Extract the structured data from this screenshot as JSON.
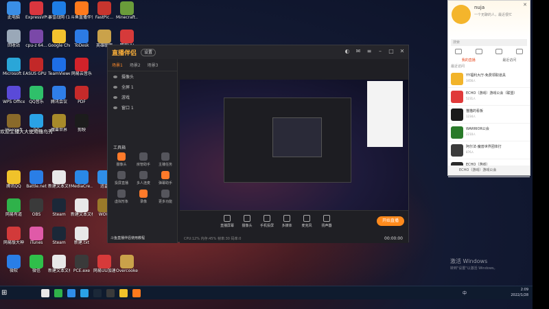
{
  "desktop": {
    "icons": [
      {
        "label": "此电脑",
        "color": "#3a8ee6",
        "col": 0,
        "row": 0
      },
      {
        "label": "ExpressVPN",
        "color": "#d9363e",
        "col": 1,
        "row": 0
      },
      {
        "label": "暴雪战网 (1)",
        "color": "#1e7ee6",
        "col": 2,
        "row": 0
      },
      {
        "label": "斗鱼直播伴侣",
        "color": "#ff7a1c",
        "col": 3,
        "row": 0
      },
      {
        "label": "FastPic...",
        "color": "#c7352e",
        "col": 4,
        "row": 0
      },
      {
        "label": "Minecraft...",
        "color": "#6a9c3a",
        "col": 5,
        "row": 0
      },
      {
        "label": "回收站",
        "color": "#9aa8b8",
        "col": 0,
        "row": 1
      },
      {
        "label": "cpu-z 64...",
        "color": "#7a48a8",
        "col": 1,
        "row": 1
      },
      {
        "label": "Google Chrome",
        "color": "#f2c12e",
        "col": 2,
        "row": 1
      },
      {
        "label": "ToDesk",
        "color": "#2c7be5",
        "col": 3,
        "row": 1
      },
      {
        "label": "英雄联盟",
        "color": "#caa24a",
        "col": 4,
        "row": 1
      },
      {
        "label": "网易UU",
        "color": "#d63a3a",
        "col": 5,
        "row": 1
      },
      {
        "label": "Microsoft Edge",
        "color": "#2aa6d8",
        "col": 0,
        "row": 2
      },
      {
        "label": "ASUS GPU Tweak II",
        "color": "#c22828",
        "col": 1,
        "row": 2
      },
      {
        "label": "TeamViewer",
        "color": "#1e6ee6",
        "col": 2,
        "row": 2
      },
      {
        "label": "网易云音乐",
        "color": "#d2222a",
        "col": 3,
        "row": 2
      },
      {
        "label": "WPS Office",
        "color": "#5a4ad8",
        "col": 0,
        "row": 3
      },
      {
        "label": "QQ音乐",
        "color": "#2fc06a",
        "col": 1,
        "row": 3
      },
      {
        "label": "腾讯会议",
        "color": "#2f7ee8",
        "col": 2,
        "row": 3
      },
      {
        "label": "PDF",
        "color": "#c62a2a",
        "col": 3,
        "row": 3
      },
      {
        "label": "Warcraft",
        "color": "#8a6a2a",
        "col": 0,
        "row": 4
      },
      {
        "label": "QQ",
        "color": "#2aa2e6",
        "col": 1,
        "row": 4
      },
      {
        "label": "魔兽世界",
        "color": "#a88a2a",
        "col": 2,
        "row": 4
      },
      {
        "label": "剪映",
        "color": "#1c1c1c",
        "col": 3,
        "row": 4
      },
      {
        "label": "腾讯QQ",
        "color": "#f0c22a",
        "col": 0,
        "row": 6
      },
      {
        "label": "Battle.net",
        "color": "#2a7ee6",
        "col": 1,
        "row": 6
      },
      {
        "label": "新建文本文档",
        "color": "#e8e8e8",
        "col": 2,
        "row": 6
      },
      {
        "label": "MediaCre...",
        "color": "#2a88e6",
        "col": 3,
        "row": 6
      },
      {
        "label": "迅雷",
        "color": "#2f8ee8",
        "col": 4,
        "row": 6
      },
      {
        "label": "网易有道",
        "color": "#2fb24a",
        "col": 0,
        "row": 7
      },
      {
        "label": "OBS",
        "color": "#3a3a3a",
        "col": 1,
        "row": 7
      },
      {
        "label": "Steam",
        "color": "#1b2838",
        "col": 2,
        "row": 7
      },
      {
        "label": "新建文本文档.txt",
        "color": "#e8e8e8",
        "col": 3,
        "row": 7
      },
      {
        "label": "WOW",
        "color": "#9a7a2a",
        "col": 4,
        "row": 7
      },
      {
        "label": "网易版大神",
        "color": "#d23a3a",
        "col": 0,
        "row": 8
      },
      {
        "label": "iTunes",
        "color": "#e05aa8",
        "col": 1,
        "row": 8
      },
      {
        "label": "Steam",
        "color": "#1b2838",
        "col": 2,
        "row": 8
      },
      {
        "label": "新建.txt",
        "color": "#e8e8e8",
        "col": 3,
        "row": 8
      },
      {
        "label": "微软",
        "color": "#2a7ee6",
        "col": 0,
        "row": 9
      },
      {
        "label": "微信",
        "color": "#2fbf4a",
        "col": 1,
        "row": 9
      },
      {
        "label": "新建文本文档 (4).txt",
        "color": "#e8e8e8",
        "col": 2,
        "row": 9
      },
      {
        "label": "PCE.exe",
        "color": "#3a3a3a",
        "col": 3,
        "row": 9
      },
      {
        "label": "网易UU加速器",
        "color": "#d63a3a",
        "col": 4,
        "row": 9
      },
      {
        "label": "Overcooked",
        "color": "#caa24a",
        "col": 5,
        "row": 9
      }
    ],
    "overlay_text": "欢迎主播大大使用撸鸟秀",
    "activate_title": "激活 Windows",
    "activate_sub": "转到\"设置\"以激活 Windows。"
  },
  "app": {
    "title": "直播伴侣",
    "badge": "设置",
    "scene_tabs": [
      "场景1",
      "场景2",
      "场景3"
    ],
    "active_scene": 0,
    "sources": [
      "摄像头",
      "全屏 1",
      "游戏",
      "窗口 1"
    ],
    "tools_label": "工具箱",
    "tools": [
      {
        "label": "摄像头",
        "hot": true
      },
      {
        "label": "房管助手",
        "hot": false
      },
      {
        "label": "主播任务",
        "hot": false
      },
      {
        "label": "投屏直播",
        "hot": false
      },
      {
        "label": "多人连麦",
        "hot": false
      },
      {
        "label": "弹幕助手",
        "hot": true
      },
      {
        "label": "虚拟形象",
        "hot": false
      },
      {
        "label": "录像",
        "hot": true
      },
      {
        "label": "更多功能",
        "hot": false
      }
    ],
    "notice": "斗鱼直播伴侣使用教程",
    "bottom_buttons": [
      "直播屏幕",
      "摄像头",
      "手机投屏",
      "多媒体",
      "麦克风",
      "扬声器"
    ],
    "go_live": "开始直播",
    "stats": "CPU:12%   内存:45%   帧率:30   码率:0",
    "timer": "00:00:00"
  },
  "qq": {
    "name": "nuja",
    "signature": "一个无聊的人，最近很忙",
    "search_placeholder": "搜索",
    "sub_tabs": [
      "我的直播",
      "最近访问"
    ],
    "active_sub_tab": 0,
    "section": "最近访问",
    "items": [
      {
        "title": "YY福利大厅-免费领取道具",
        "sub": "3456人",
        "color": "#f2b42a"
      },
      {
        "title": "ECHO（游戏）游戏公会（联盟）",
        "sub": "5231人",
        "color": "#e03a3a"
      },
      {
        "title": "猫猫的看板",
        "sub": "1234人",
        "color": "#1a1a1a"
      },
      {
        "title": "WARRIOR公会",
        "sub": "2210人",
        "color": "#2a7a2a"
      },
      {
        "title": "阿尔法-魔兽世界团体打",
        "sub": "876人",
        "color": "#3a3a3a"
      },
      {
        "title": "ECHO（游戏）",
        "sub": "1108人",
        "color": "#2a2a2a"
      }
    ],
    "footer": "ECHO（游戏）游戏公会"
  },
  "taskbar": {
    "apps": [
      {
        "color": "#e8e8e8"
      },
      {
        "color": "#2fb24a"
      },
      {
        "color": "#2f8ee8"
      },
      {
        "color": "#2aa2e6"
      },
      {
        "color": "#1b2838"
      },
      {
        "color": "#3a3a3a"
      },
      {
        "color": "#f0c22a"
      },
      {
        "color": "#ff7a1c"
      }
    ],
    "lang": "中",
    "time": "2:09",
    "date": "2022/1/28"
  }
}
